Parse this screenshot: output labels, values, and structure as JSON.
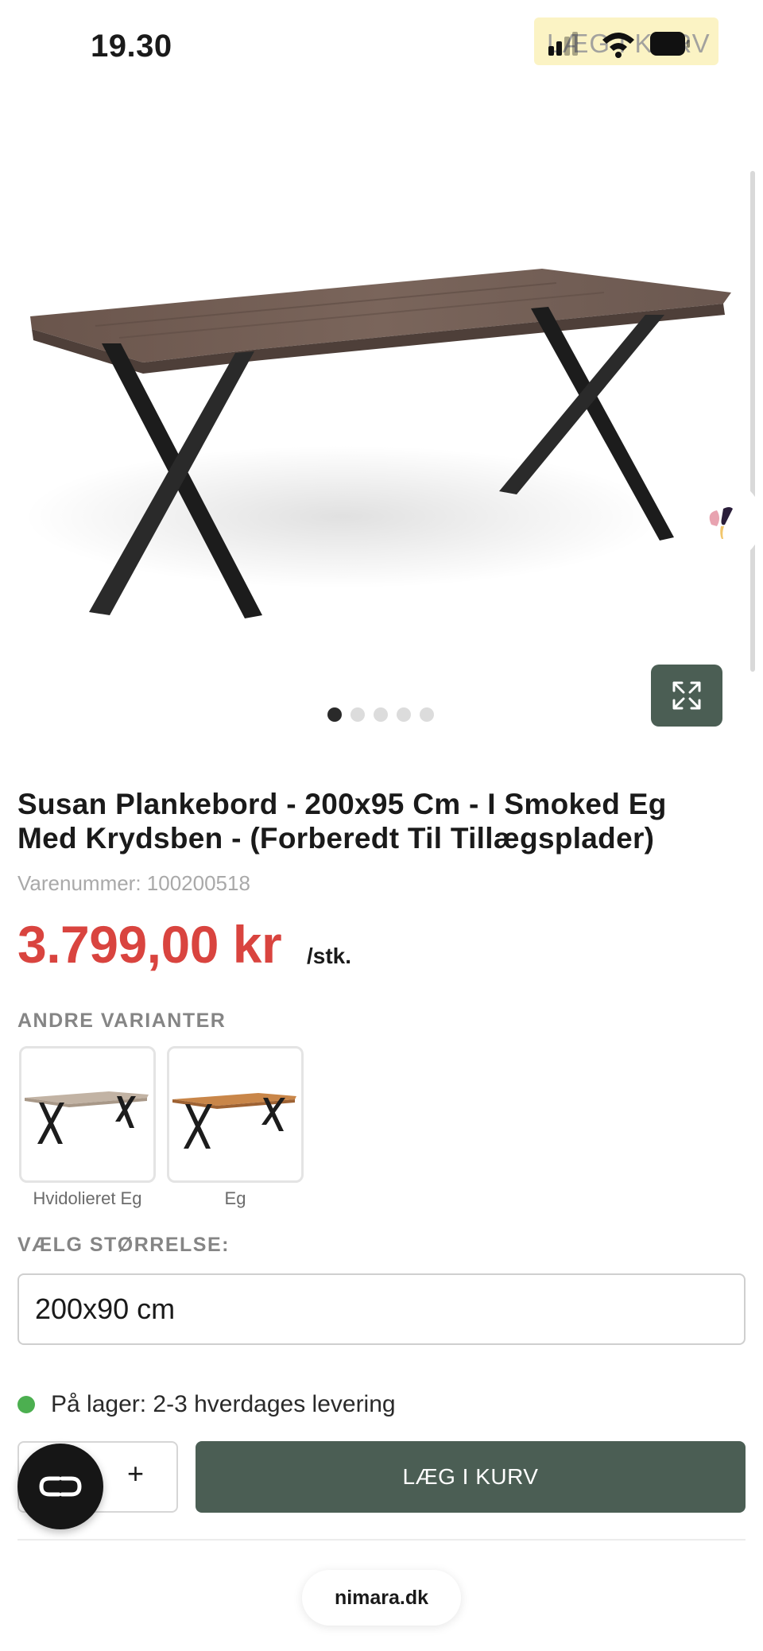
{
  "status_bar": {
    "time": "19.30",
    "pill_text": "LÆG I KURV"
  },
  "gallery": {
    "slide_count": 5,
    "active_index": 0,
    "expand_icon": "expand-arrows-icon"
  },
  "product": {
    "title": "Susan Plankebord - 200x95 Cm - I Smoked Eg Med Krydsben - (Forberedt Til Tillægsplader)",
    "sku": "Varenummer: 100200518",
    "price": "3.799,00 kr",
    "unit": "/stk."
  },
  "variants": {
    "heading": "ANDRE VARIANTER",
    "items": [
      {
        "label": "Hvidolieret Eg",
        "top_color": "#c2b3a4"
      },
      {
        "label": "Eg",
        "top_color": "#c98649"
      }
    ]
  },
  "size": {
    "heading": "VÆLG STØRRELSE:",
    "selected": "200x90 cm"
  },
  "stock": {
    "text": "På lager: 2-3 hverdages levering",
    "color": "#4caf50"
  },
  "purchase": {
    "quantity_plus": "+",
    "add_to_cart": "LÆG I KURV",
    "accent_color": "#4b5e54"
  },
  "browser": {
    "domain": "nimara.dk"
  },
  "colors": {
    "price": "#d9443f",
    "table_top": "#6e5b52",
    "legs": "#1c1c1c"
  }
}
